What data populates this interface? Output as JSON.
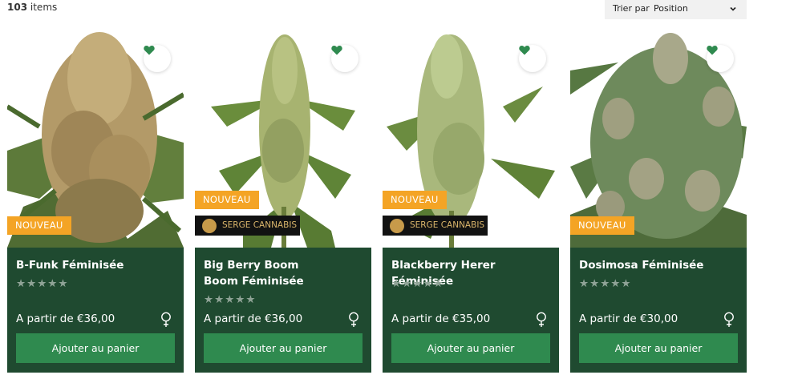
{
  "toolbar": {
    "count_number": "103",
    "count_label": "items",
    "sort_label": "Trier par",
    "sort_value": "Position"
  },
  "colors": {
    "card_bg": "#1f4a30",
    "button_bg": "#2f8a4f",
    "badge_new": "#f4a425",
    "badge_brand_bg": "#121212",
    "heart": "#2f8a4f"
  },
  "products": [
    {
      "name": "B-Funk Féminisée",
      "badge_new": "NOUVEAU",
      "badge_brand": "",
      "stars": "★★★★★",
      "rating": 0,
      "price": "A partir de €36,00",
      "button": "Ajouter au panier",
      "gender_icon": "female-icon",
      "favorite_icon": "heart-icon"
    },
    {
      "name": "Big Berry Boom Boom Féminisée",
      "badge_new": "NOUVEAU",
      "badge_brand": "SERGE CANNABIS",
      "stars": "★★★★★",
      "rating": 0,
      "price": "A partir de €36,00",
      "button": "Ajouter au panier",
      "gender_icon": "female-icon",
      "favorite_icon": "heart-icon"
    },
    {
      "name": "Blackberry Herer Féminisée",
      "badge_new": "NOUVEAU",
      "badge_brand": "SERGE CANNABIS",
      "stars": "★★★★★",
      "rating": 0,
      "price": "A partir de €35,00",
      "button": "Ajouter au panier",
      "gender_icon": "female-icon",
      "favorite_icon": "heart-icon"
    },
    {
      "name": "Dosimosa Féminisée",
      "badge_new": "NOUVEAU",
      "badge_brand": "",
      "stars": "★★★★★",
      "rating": 0,
      "price": "A partir de €30,00",
      "button": "Ajouter au panier",
      "gender_icon": "female-icon",
      "favorite_icon": "heart-icon"
    }
  ]
}
